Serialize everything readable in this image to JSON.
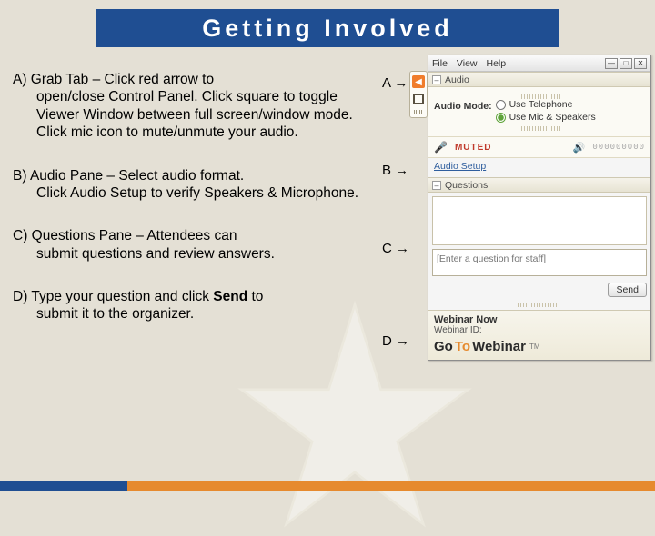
{
  "title": "Getting Involved",
  "paragraphs": {
    "a_lead": "A) Grab Tab – Click red arrow to",
    "a_rest": "open/close Control Panel. Click square to toggle Viewer Window between full screen/window mode. Click mic icon to mute/unmute your audio.",
    "b_lead": "B) Audio Pane – Select audio format.",
    "b_rest": "Click Audio Setup to verify Speakers & Microphone.",
    "c_lead": "C) Questions Pane – Attendees can",
    "c_rest": "submit questions and review answers.",
    "d_lead_1": "D) Type your question and click ",
    "d_bold": "Send",
    "d_lead_2": " to",
    "d_rest": "submit it to the organizer."
  },
  "markers": {
    "a": "A →",
    "b": "B →",
    "c": "C →",
    "d": "D →"
  },
  "panel": {
    "menu": {
      "file": "File",
      "view": "View",
      "help": "Help"
    },
    "sections": {
      "audio": "Audio",
      "questions": "Questions"
    },
    "audio": {
      "mode_label": "Audio Mode:",
      "opt_phone": "Use Telephone",
      "opt_mic": "Use Mic & Speakers",
      "muted": "MUTED",
      "volume": "000000000",
      "setup_link": "Audio Setup"
    },
    "questions": {
      "placeholder": "[Enter a question for staff]",
      "send": "Send"
    },
    "footer": {
      "title": "Webinar Now",
      "id_label": "Webinar ID:",
      "brand_go": "Go",
      "brand_to": "To",
      "brand_web": "Webinar",
      "tm": "TM"
    }
  }
}
